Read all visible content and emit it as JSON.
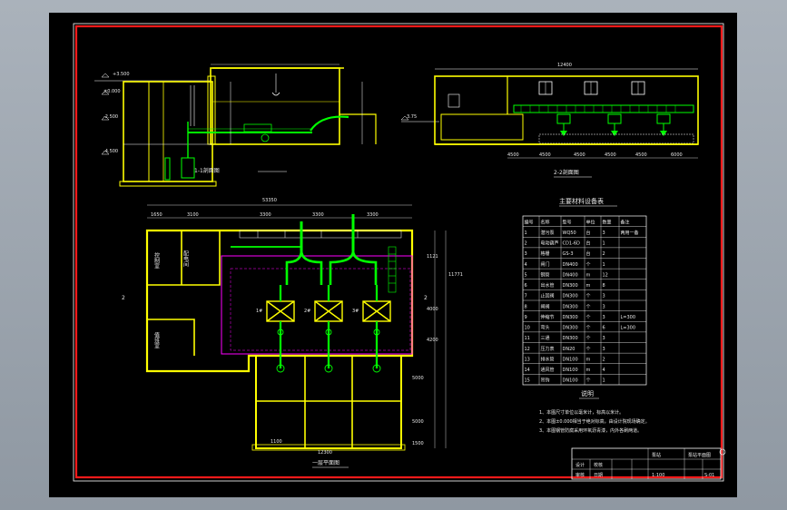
{
  "drawing": {
    "section_1_label": "1-1剖面图",
    "section_2_label": "2-2剖面图",
    "plan_label": "一层平面图",
    "plan_total_width": "53350",
    "plan_dims": [
      "1650",
      "3100",
      "3300",
      "3300",
      "3300"
    ],
    "plan_height_dims": [
      "11771",
      "1121",
      "4000",
      "4200",
      "5000",
      "5000",
      "1500"
    ],
    "section2_total": "12400",
    "section2_dims": [
      "4500",
      "4500",
      "4500",
      "4500",
      "4500",
      "6000"
    ],
    "bottom_dims": [
      "1100",
      "12300"
    ],
    "room_control": "控制室",
    "room_elec": "配电间",
    "room_duty": "值班室",
    "pump_labels": [
      "1#",
      "2#",
      "3#"
    ],
    "marker_2": "2",
    "section1_levels": [
      "±0.000",
      "-2.500",
      "-3.500",
      "-4.500",
      "-5.000",
      "+3.500",
      "3.75"
    ]
  },
  "equipment_table": {
    "title": "主要材料设备表",
    "headers": [
      "编号",
      "名称",
      "型号",
      "单位",
      "数量",
      "备注"
    ],
    "rows": [
      [
        "1",
        "潜污泵",
        "WQ50",
        "台",
        "3",
        "两用一备"
      ],
      [
        "2",
        "电动葫芦",
        "CD1-6D",
        "台",
        "1",
        ""
      ],
      [
        "3",
        "格栅",
        "GS-3",
        "台",
        "2",
        ""
      ],
      [
        "4",
        "闸门",
        "DN400",
        "个",
        "1",
        ""
      ],
      [
        "5",
        "钢管",
        "DN400",
        "m",
        "12",
        ""
      ],
      [
        "6",
        "出水管",
        "DN300",
        "m",
        "8",
        ""
      ],
      [
        "7",
        "止回阀",
        "DN300",
        "个",
        "3",
        ""
      ],
      [
        "8",
        "闸阀",
        "DN300",
        "个",
        "3",
        ""
      ],
      [
        "9",
        "伸缩节",
        "DN300",
        "个",
        "3",
        "L=300"
      ],
      [
        "10",
        "弯头",
        "DN300",
        "个",
        "6",
        "L=300"
      ],
      [
        "11",
        "三通",
        "DN300",
        "个",
        "3",
        ""
      ],
      [
        "12",
        "压力表",
        "DN20",
        "个",
        "3",
        ""
      ],
      [
        "13",
        "排水管",
        "DN100",
        "m",
        "2",
        ""
      ],
      [
        "14",
        "通风管",
        "DN100",
        "m",
        "4",
        ""
      ],
      [
        "15",
        "吊钩",
        "DN100",
        "个",
        "1",
        ""
      ]
    ]
  },
  "notes": {
    "title": "说明",
    "lines": [
      "1、本图尺寸单位以毫米计，标高以米计。",
      "2、本图±0.000相当于绝对标高，由设计院现场确定。",
      "3、本图钢管防腐采用环氧沥青漆，内外各刷两道。"
    ]
  },
  "title_block": {
    "project": "泵站平面图",
    "drawing_name": "泵站",
    "labels": [
      "设计",
      "校核",
      "审核",
      "日期"
    ],
    "sheet": "1:100",
    "number": "S-01"
  },
  "colors": {
    "background": "#000000",
    "frame_red": "#ff1a1a",
    "wall_yellow": "#ffff00",
    "pipe_green": "#00ff00",
    "magenta": "#ff00ff",
    "white": "#ffffff",
    "cyan": "#00ffff"
  }
}
